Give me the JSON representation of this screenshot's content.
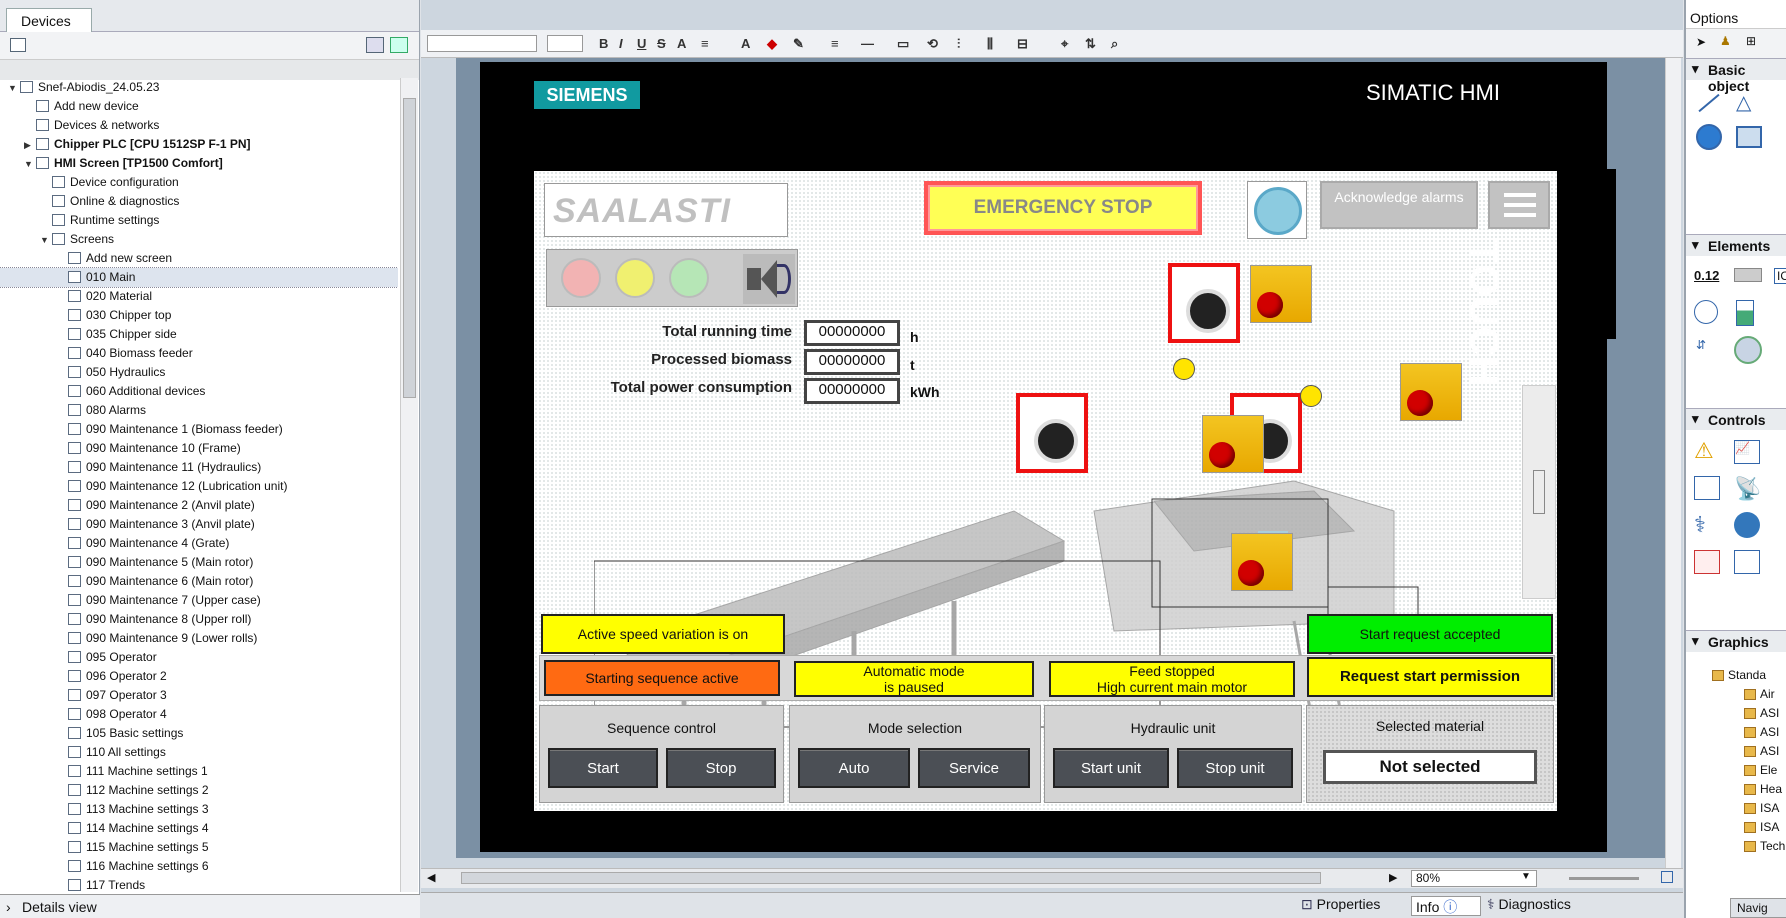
{
  "left_panel": {
    "tab": "Devices",
    "details_view": "Details view",
    "tree": [
      {
        "label": "Snef-Abiodis_24.05.23",
        "indent": 0,
        "arrow": "▼",
        "bold": false
      },
      {
        "label": "Add new device",
        "indent": 1,
        "arrow": "",
        "bold": false
      },
      {
        "label": "Devices & networks",
        "indent": 1,
        "arrow": "",
        "bold": false
      },
      {
        "label": "Chipper PLC [CPU 1512SP F-1 PN]",
        "indent": 1,
        "arrow": "▶",
        "bold": true
      },
      {
        "label": "HMI Screen [TP1500 Comfort]",
        "indent": 1,
        "arrow": "▼",
        "bold": true
      },
      {
        "label": "Device configuration",
        "indent": 2,
        "arrow": "",
        "bold": false
      },
      {
        "label": "Online & diagnostics",
        "indent": 2,
        "arrow": "",
        "bold": false
      },
      {
        "label": "Runtime settings",
        "indent": 2,
        "arrow": "",
        "bold": false
      },
      {
        "label": "Screens",
        "indent": 2,
        "arrow": "▼",
        "bold": false
      },
      {
        "label": "Add new screen",
        "indent": 3,
        "arrow": "",
        "bold": false
      },
      {
        "label": "010 Main",
        "indent": 3,
        "arrow": "",
        "bold": false,
        "selected": true
      },
      {
        "label": "020 Material",
        "indent": 3,
        "arrow": "",
        "bold": false
      },
      {
        "label": "030 Chipper top",
        "indent": 3,
        "arrow": "",
        "bold": false
      },
      {
        "label": "035 Chipper side",
        "indent": 3,
        "arrow": "",
        "bold": false
      },
      {
        "label": "040 Biomass feeder",
        "indent": 3,
        "arrow": "",
        "bold": false
      },
      {
        "label": "050 Hydraulics",
        "indent": 3,
        "arrow": "",
        "bold": false
      },
      {
        "label": "060 Additional devices",
        "indent": 3,
        "arrow": "",
        "bold": false
      },
      {
        "label": "080 Alarms",
        "indent": 3,
        "arrow": "",
        "bold": false
      },
      {
        "label": "090 Maintenance 1 (Biomass feeder)",
        "indent": 3,
        "arrow": "",
        "bold": false
      },
      {
        "label": "090 Maintenance 10 (Frame)",
        "indent": 3,
        "arrow": "",
        "bold": false
      },
      {
        "label": "090 Maintenance 11 (Hydraulics)",
        "indent": 3,
        "arrow": "",
        "bold": false
      },
      {
        "label": "090 Maintenance 12 (Lubrication unit)",
        "indent": 3,
        "arrow": "",
        "bold": false
      },
      {
        "label": "090 Maintenance 2 (Anvil plate)",
        "indent": 3,
        "arrow": "",
        "bold": false
      },
      {
        "label": "090 Maintenance 3 (Anvil plate)",
        "indent": 3,
        "arrow": "",
        "bold": false
      },
      {
        "label": "090 Maintenance 4 (Grate)",
        "indent": 3,
        "arrow": "",
        "bold": false
      },
      {
        "label": "090 Maintenance 5 (Main rotor)",
        "indent": 3,
        "arrow": "",
        "bold": false
      },
      {
        "label": "090 Maintenance 6 (Main rotor)",
        "indent": 3,
        "arrow": "",
        "bold": false
      },
      {
        "label": "090 Maintenance 7 (Upper case)",
        "indent": 3,
        "arrow": "",
        "bold": false
      },
      {
        "label": "090 Maintenance 8 (Upper roll)",
        "indent": 3,
        "arrow": "",
        "bold": false
      },
      {
        "label": "090 Maintenance 9 (Lower rolls)",
        "indent": 3,
        "arrow": "",
        "bold": false
      },
      {
        "label": "095 Operator",
        "indent": 3,
        "arrow": "",
        "bold": false
      },
      {
        "label": "096 Operator 2",
        "indent": 3,
        "arrow": "",
        "bold": false
      },
      {
        "label": "097 Operator 3",
        "indent": 3,
        "arrow": "",
        "bold": false
      },
      {
        "label": "098 Operator 4",
        "indent": 3,
        "arrow": "",
        "bold": false
      },
      {
        "label": "105 Basic settings",
        "indent": 3,
        "arrow": "",
        "bold": false
      },
      {
        "label": "110 All settings",
        "indent": 3,
        "arrow": "",
        "bold": false
      },
      {
        "label": "111 Machine settings 1",
        "indent": 3,
        "arrow": "",
        "bold": false
      },
      {
        "label": "112 Machine settings 2",
        "indent": 3,
        "arrow": "",
        "bold": false
      },
      {
        "label": "113 Machine settings 3",
        "indent": 3,
        "arrow": "",
        "bold": false
      },
      {
        "label": "114 Machine settings 4",
        "indent": 3,
        "arrow": "",
        "bold": false
      },
      {
        "label": "115 Machine settings 5",
        "indent": 3,
        "arrow": "",
        "bold": false
      },
      {
        "label": "116 Machine settings 6",
        "indent": 3,
        "arrow": "",
        "bold": false
      },
      {
        "label": "117 Trends",
        "indent": 3,
        "arrow": "",
        "bold": false
      }
    ]
  },
  "editor": {
    "zoom": "80%",
    "bottom_tabs": {
      "properties": "Properties",
      "info": "Info",
      "diagnostics": "Diagnostics"
    }
  },
  "hmi": {
    "brand": "SIEMENS",
    "simatic": "SIMATIC HMI",
    "touch": "TOUCH",
    "logo_text": "SAALASTI",
    "emergency_stop": "EMERGENCY STOP",
    "ack_alarms": "Acknowledge alarms",
    "counters": {
      "running_label": "Total running time",
      "running_value": "00000000",
      "running_unit": "h",
      "biomass_label": "Processed biomass",
      "biomass_value": "00000000",
      "biomass_unit": "t",
      "power_label": "Total power consumption",
      "power_value": "00000000",
      "power_unit": "kWh"
    },
    "status": {
      "speed_variation": "Active speed variation is on",
      "start_accepted": "Start request accepted",
      "starting_sequence": "Starting sequence active",
      "auto_paused_1": "Automatic mode",
      "auto_paused_2": "is paused",
      "feed_stopped_1": "Feed stopped",
      "feed_stopped_2": "High current main motor",
      "request_permission": "Request start permission"
    },
    "sequence": {
      "title": "Sequence control",
      "start": "Start",
      "stop": "Stop"
    },
    "mode": {
      "title": "Mode selection",
      "auto": "Auto",
      "service": "Service"
    },
    "hydraulic": {
      "title": "Hydraulic unit",
      "start": "Start unit",
      "stop": "Stop unit"
    },
    "material": {
      "title": "Selected material",
      "value": "Not selected"
    }
  },
  "right_panel": {
    "options": "Options",
    "basic_objects": "Basic object",
    "elements": "Elements",
    "controls": "Controls",
    "graphics": "Graphics",
    "graphics_tree": [
      "Standa",
      "Air",
      "ASI",
      "ASI",
      "ASI",
      "Ele",
      "Hea",
      "ISA",
      "ISA",
      "Techn"
    ],
    "navig": "Navig",
    "elem_label_1": "0.12",
    "elem_label_2": "IO"
  }
}
